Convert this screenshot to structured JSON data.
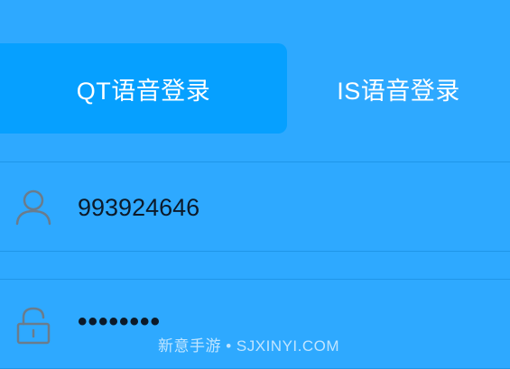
{
  "tabs": [
    {
      "label": "QT语音登录",
      "active": true
    },
    {
      "label": "IS语音登录",
      "active": false
    }
  ],
  "form": {
    "username_value": "993924646",
    "password_value": "••••••••",
    "user_icon": "user-icon",
    "lock_icon": "lock-icon"
  },
  "watermark": "新意手游 • SJXINYI.COM",
  "colors": {
    "background": "#2ea9ff",
    "active_tab": "#06a0ff",
    "text": "#ffffff",
    "input_text": "#0c1a2a",
    "icon": "#6a7c8c"
  }
}
